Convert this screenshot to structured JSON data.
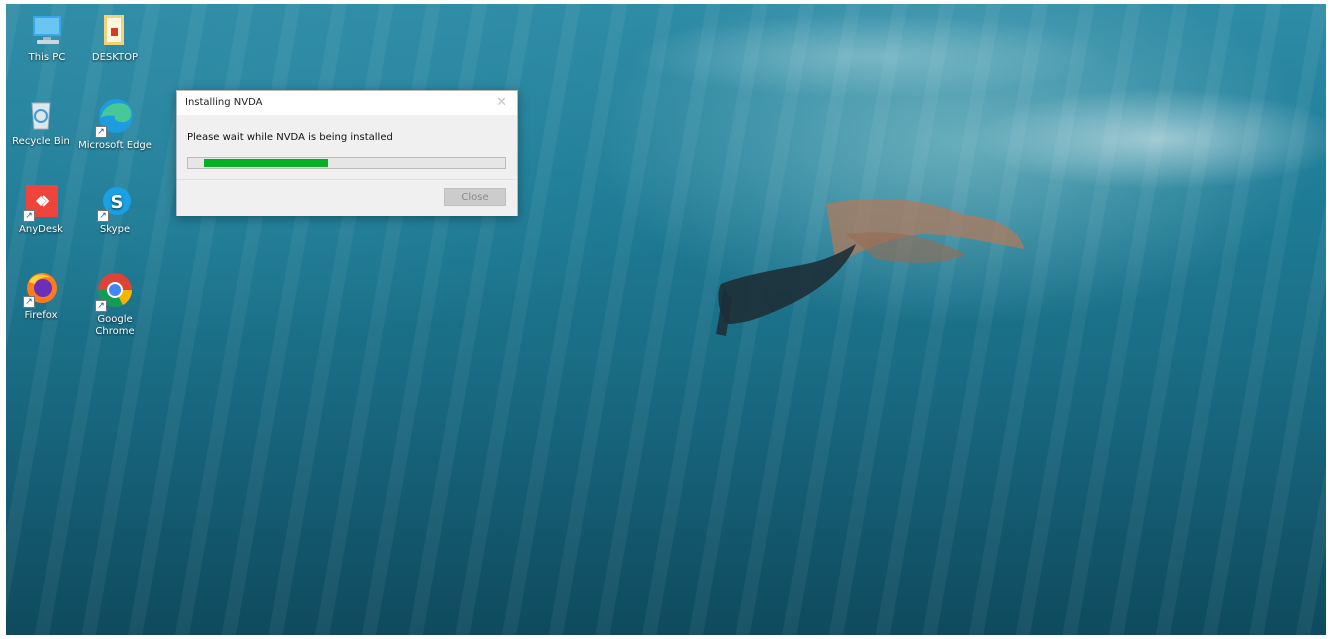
{
  "desktop": {
    "icons": [
      {
        "label": "This PC",
        "icon": "this-pc-icon"
      },
      {
        "label": "DESKTOP",
        "icon": "folder-icon"
      },
      {
        "label": "Recycle Bin",
        "icon": "recycle-bin-icon"
      },
      {
        "label": "Microsoft Edge",
        "icon": "edge-icon"
      },
      {
        "label": "AnyDesk",
        "icon": "anydesk-icon"
      },
      {
        "label": "Skype",
        "icon": "skype-icon"
      },
      {
        "label": "Firefox",
        "icon": "firefox-icon"
      },
      {
        "label": "Google Chrome",
        "icon": "chrome-icon"
      }
    ]
  },
  "dialog": {
    "title": "Installing NVDA",
    "message": "Please wait while NVDA is being installed",
    "progress": 0.39,
    "close_label": "Close"
  },
  "colors": {
    "progress_fill": "#06b025",
    "dialog_bg": "#f0f0f0"
  }
}
